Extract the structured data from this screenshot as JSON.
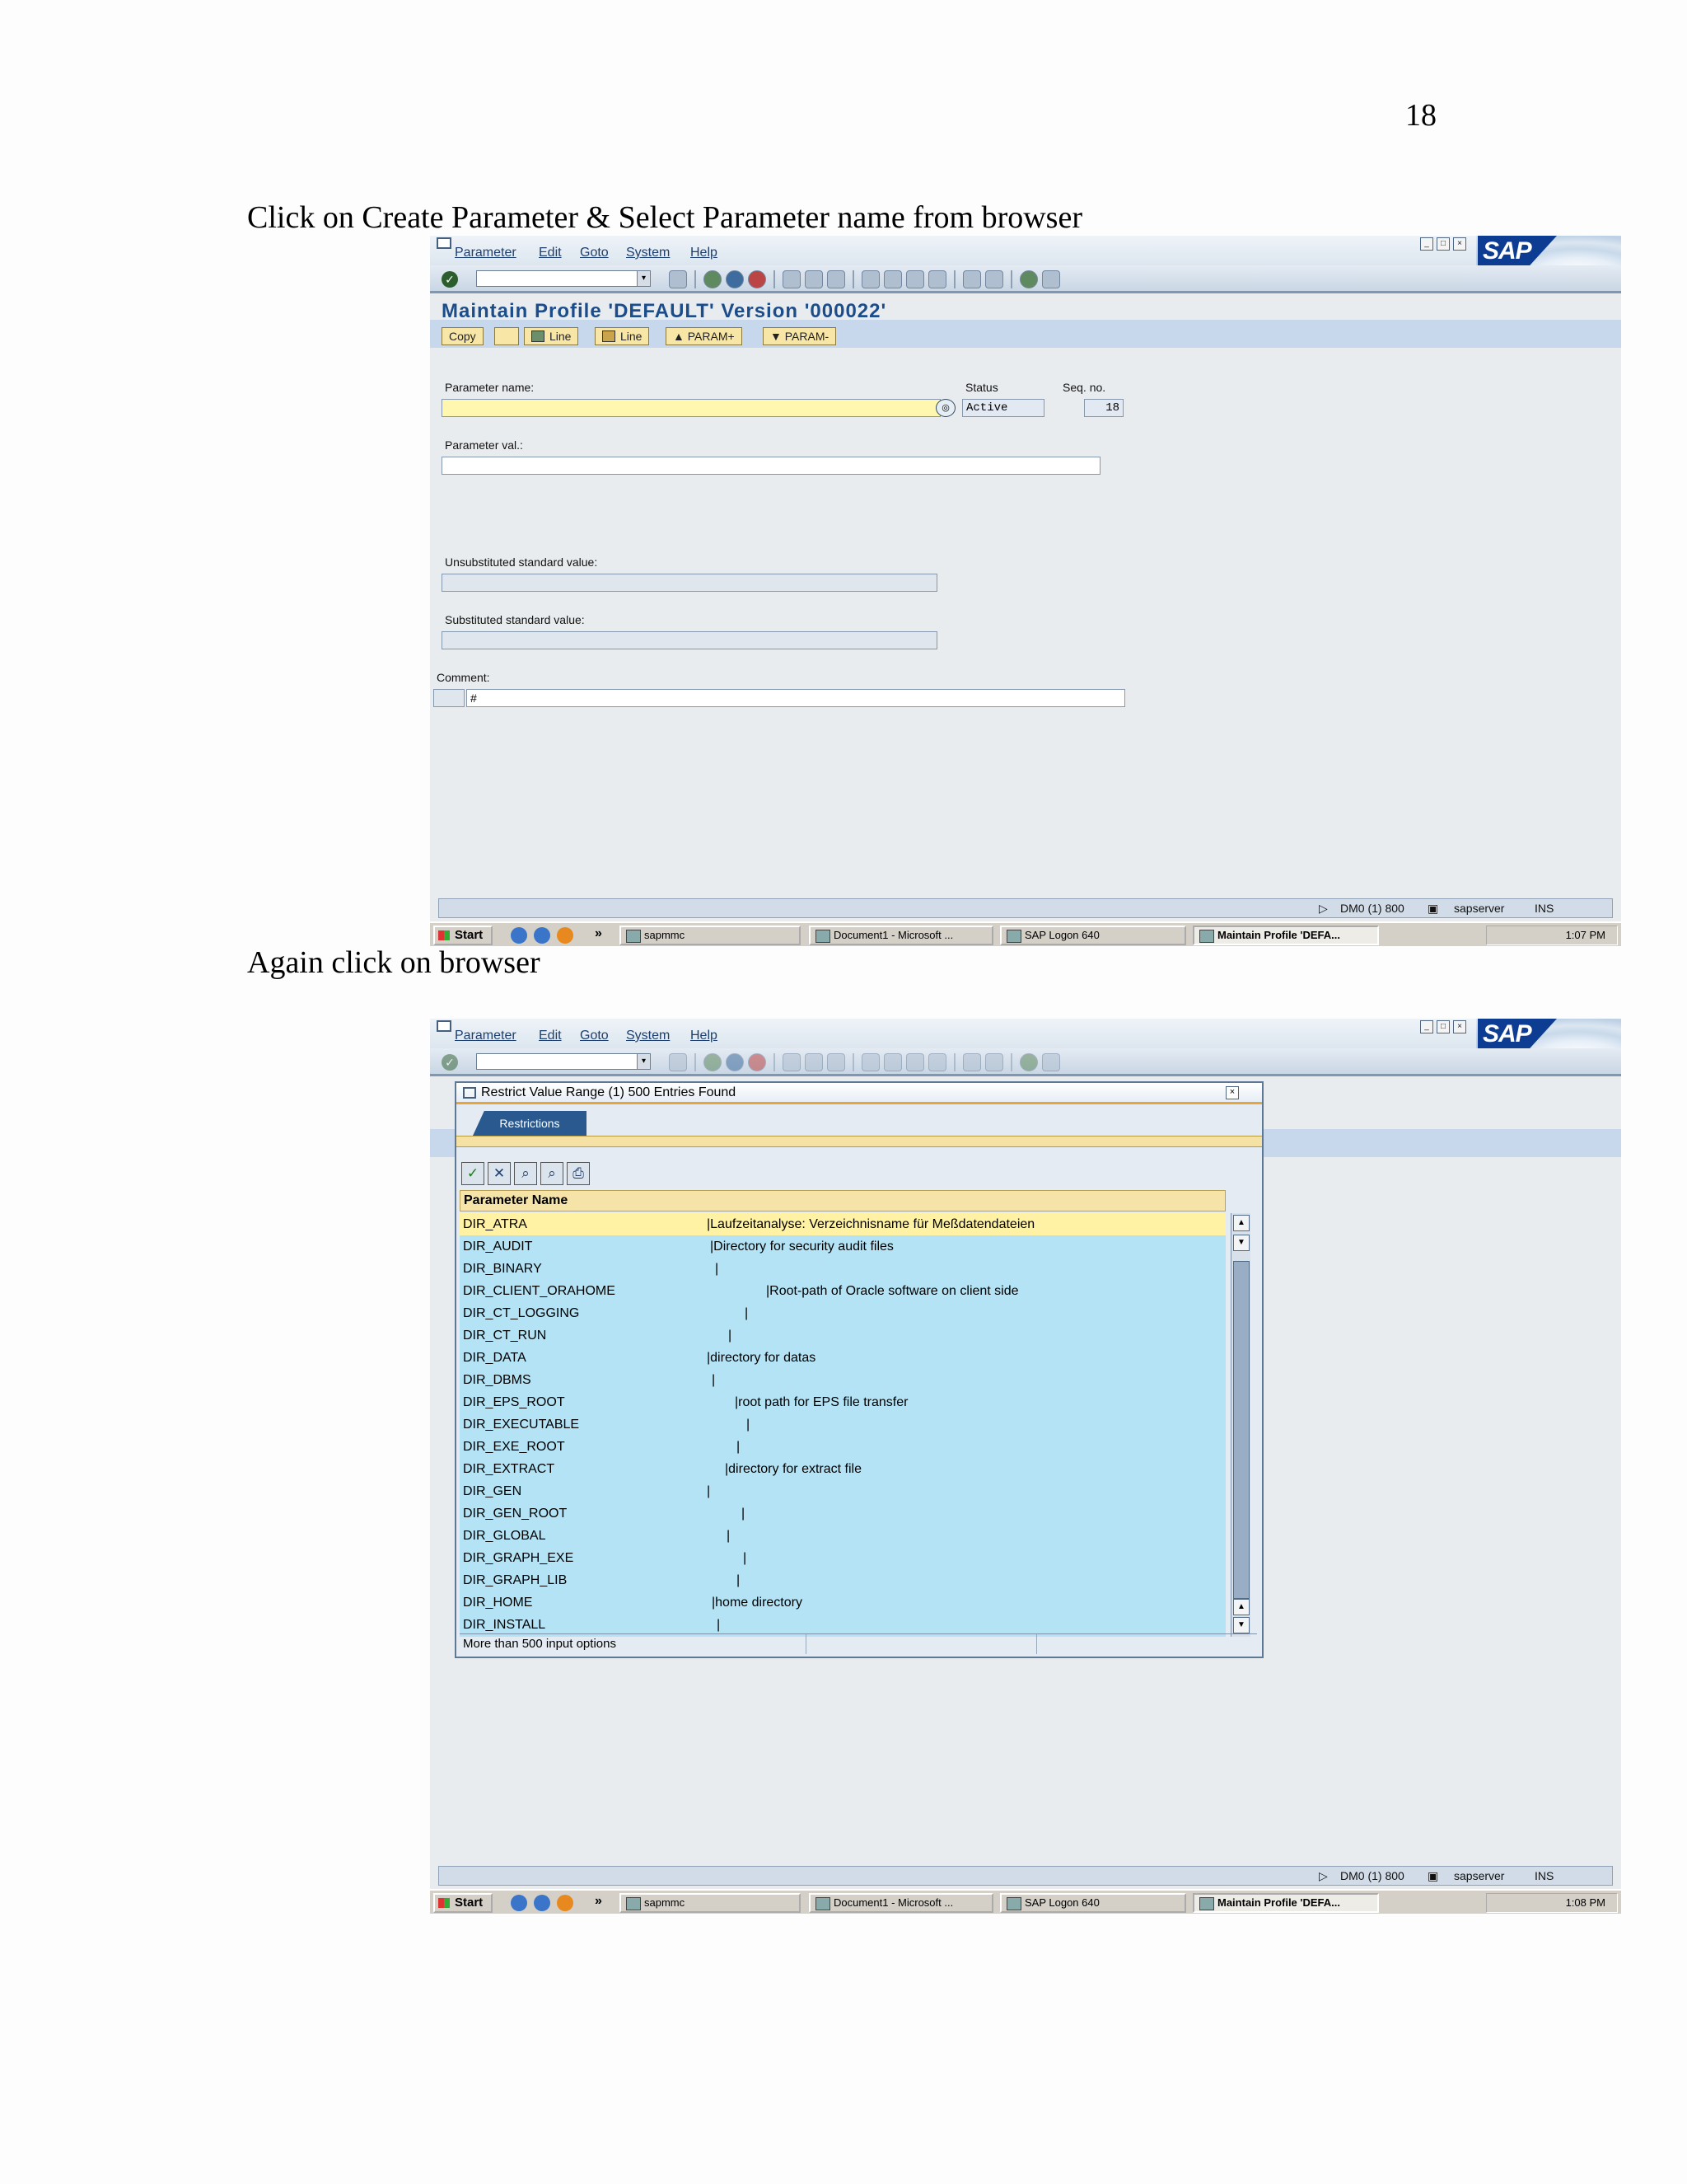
{
  "page_number": "18",
  "captions": {
    "first": "Click on Create Parameter & Select Parameter name from browser",
    "second": "Again click on browser"
  },
  "sap": {
    "logo_text": "SAP",
    "menu": [
      "Parameter",
      "Edit",
      "Goto",
      "System",
      "Help"
    ],
    "title": "Maintain Profile 'DEFAULT' Version '000022'",
    "app_buttons": [
      "Copy",
      "Line",
      "Line",
      "PARAM+",
      "PARAM-"
    ],
    "form": {
      "param_name_label": "Parameter name:",
      "status_label": "Status",
      "status_value": "Active",
      "seq_label": "Seq. no.",
      "seq_value": "18",
      "param_val_label": "Parameter val.:",
      "unsubst_label": "Unsubstituted standard value:",
      "subst_label": "Substituted standard value:",
      "comment_label": "Comment:",
      "comment_value": "#"
    },
    "status_bar": {
      "system": "DM0 (1) 800",
      "server": "sapserver",
      "mode": "INS"
    },
    "taskbar": {
      "start": "Start",
      "tasks": [
        "sapmmc",
        "Document1 - Microsoft ...",
        "SAP Logon 640",
        "Maintain Profile 'DEFA..."
      ],
      "time_first": "1:07 PM",
      "time_second": "1:08 PM"
    }
  },
  "popup": {
    "title": "Restrict Value Range (1)  500 Entries Found",
    "tab": "Restrictions",
    "column_header": "Parameter Name",
    "rows": [
      {
        "name": "DIR_ATRA",
        "desc": "|Laufzeitanalyse: Verzeichnisname für Meßdatendateien"
      },
      {
        "name": "DIR_AUDIT",
        "desc": "|Directory for security audit files"
      },
      {
        "name": "DIR_BINARY",
        "desc": "|"
      },
      {
        "name": "DIR_CLIENT_ORAHOME",
        "desc": "|Root-path of Oracle software on client side"
      },
      {
        "name": "DIR_CT_LOGGING",
        "desc": "|"
      },
      {
        "name": "DIR_CT_RUN",
        "desc": "|"
      },
      {
        "name": "DIR_DATA",
        "desc": "|directory for datas"
      },
      {
        "name": "DIR_DBMS",
        "desc": "|"
      },
      {
        "name": "DIR_EPS_ROOT",
        "desc": "|root path for EPS file transfer"
      },
      {
        "name": "DIR_EXECUTABLE",
        "desc": "|"
      },
      {
        "name": "DIR_EXE_ROOT",
        "desc": "|"
      },
      {
        "name": "DIR_EXTRACT",
        "desc": "|directory for extract file"
      },
      {
        "name": "DIR_GEN",
        "desc": "|"
      },
      {
        "name": "DIR_GEN_ROOT",
        "desc": "|"
      },
      {
        "name": "DIR_GLOBAL",
        "desc": "|"
      },
      {
        "name": "DIR_GRAPH_EXE",
        "desc": "|"
      },
      {
        "name": "DIR_GRAPH_LIB",
        "desc": "|"
      },
      {
        "name": "DIR_HOME",
        "desc": "|home directory"
      },
      {
        "name": "DIR_INSTALL",
        "desc": "|"
      }
    ],
    "status_text": "More than  500 input options"
  }
}
